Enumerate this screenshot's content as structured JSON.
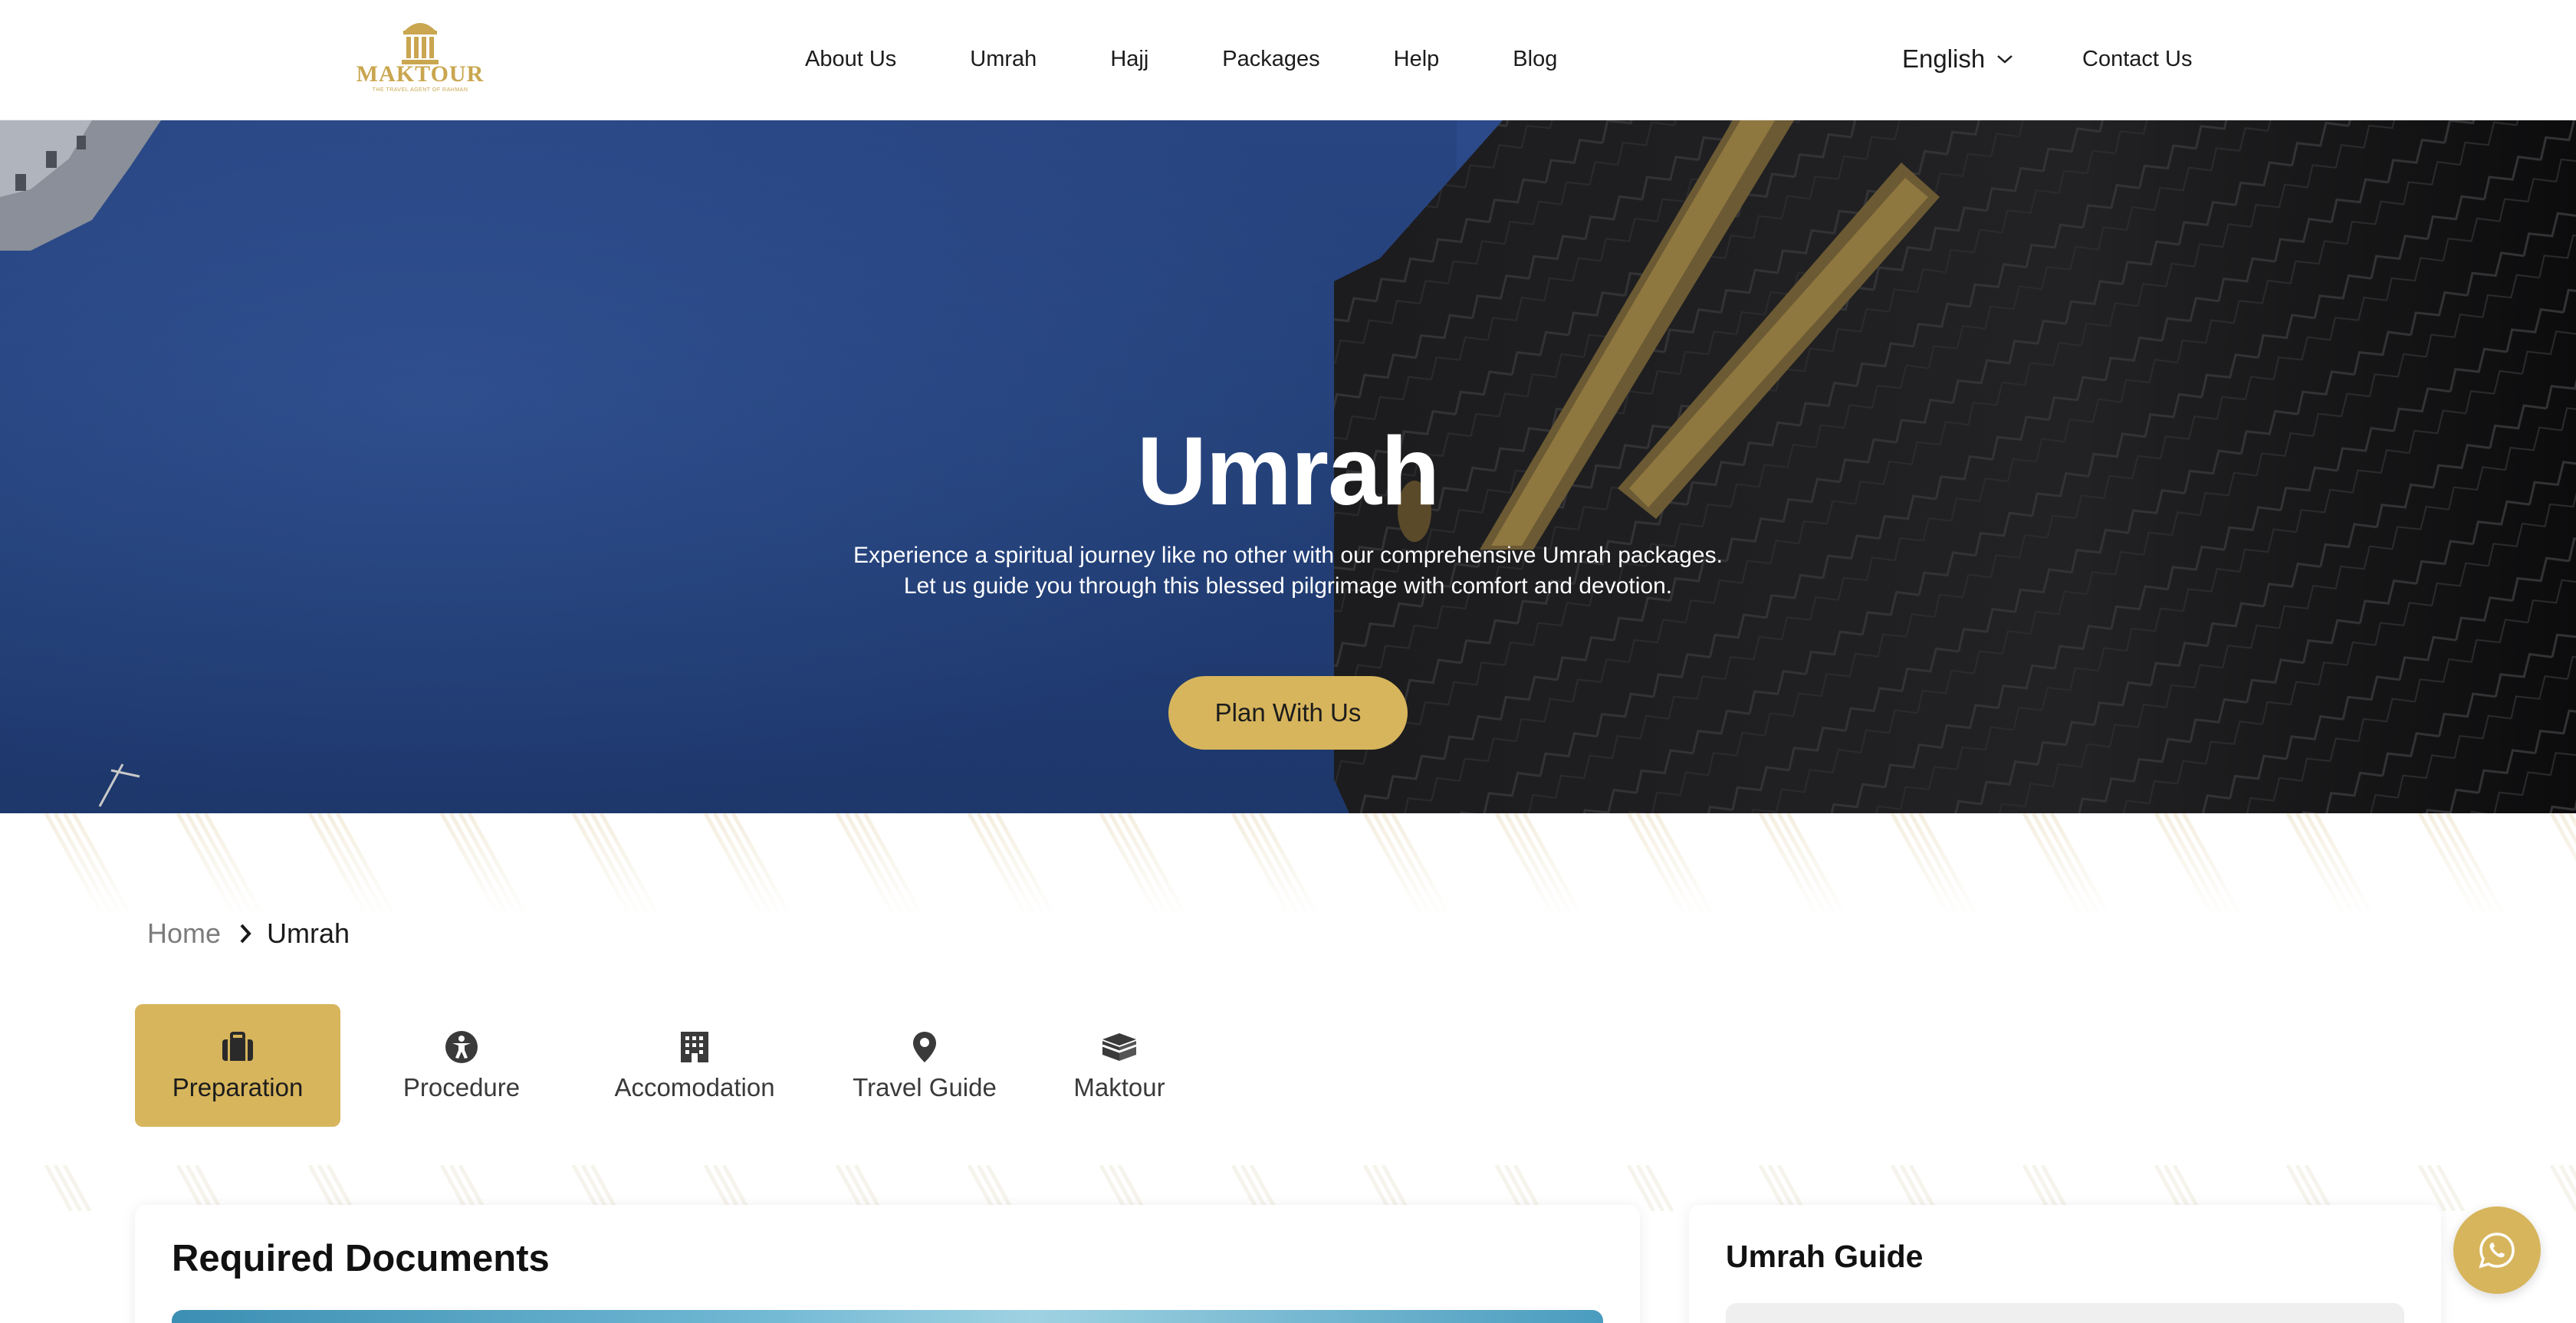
{
  "header": {
    "logo_text": "MAKTOUR",
    "logo_tagline": "THE TRAVEL AGENT OF RAHMAN",
    "nav": [
      "About Us",
      "Umrah",
      "Hajj",
      "Packages",
      "Help",
      "Blog"
    ],
    "language": "English",
    "contact": "Contact Us"
  },
  "hero": {
    "title": "Umrah",
    "subtitle": "Experience a spiritual journey like no other with our comprehensive Umrah packages. Let us guide you through this blessed pilgrimage with comfort and devotion.",
    "cta": "Plan With Us"
  },
  "breadcrumb": {
    "home": "Home",
    "current": "Umrah"
  },
  "tabs": [
    {
      "label": "Preparation",
      "icon": "briefcase-icon",
      "active": true
    },
    {
      "label": "Procedure",
      "icon": "accessibility-icon",
      "active": false
    },
    {
      "label": "Accomodation",
      "icon": "building-icon",
      "active": false
    },
    {
      "label": "Travel Guide",
      "icon": "location-pin-icon",
      "active": false
    },
    {
      "label": "Maktour",
      "icon": "kaaba-icon",
      "active": false
    }
  ],
  "main": {
    "section_title": "Required Documents"
  },
  "sidebar": {
    "title": "Umrah Guide"
  },
  "colors": {
    "accent": "#d7b55c",
    "hero_sky": "#26447f",
    "text": "#1a1a1a"
  }
}
